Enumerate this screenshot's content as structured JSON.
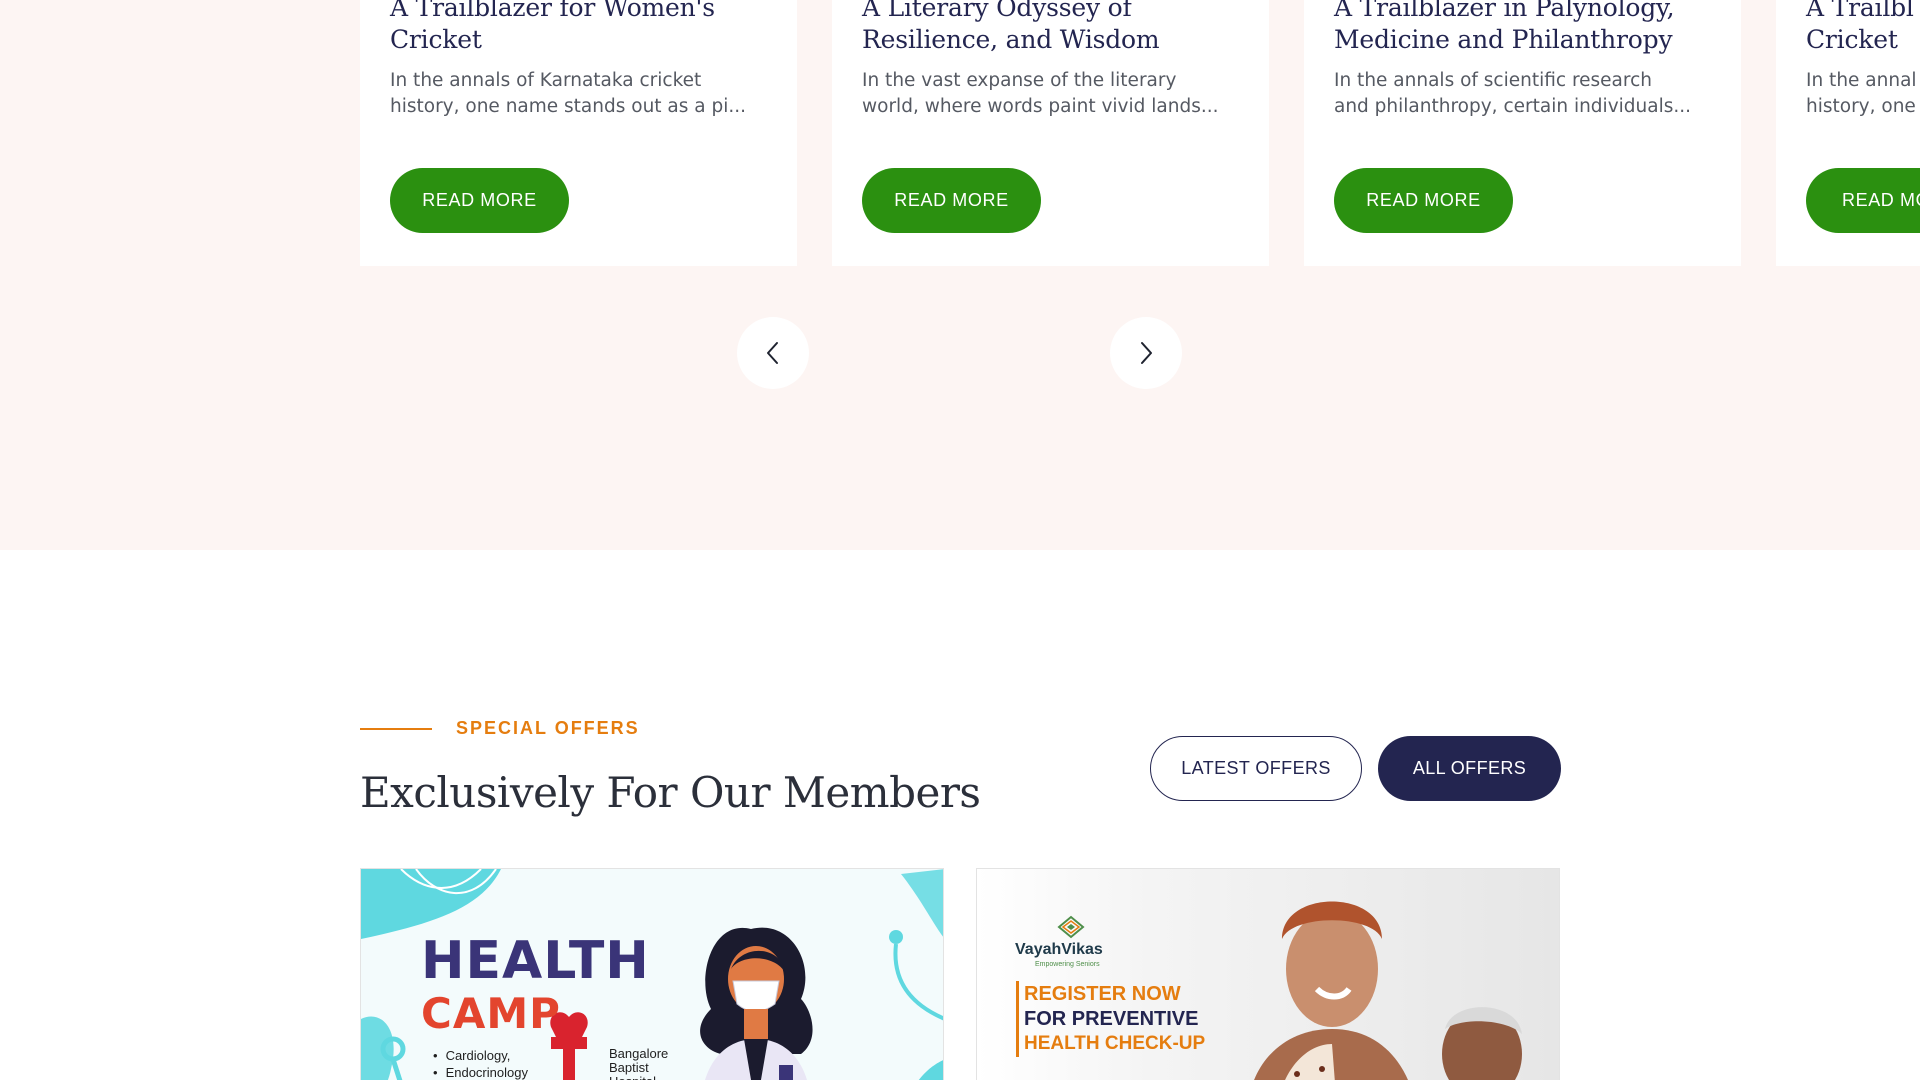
{
  "stories": {
    "cards": [
      {
        "title_line1": "A Trailblazer for Women's",
        "title_line2": "Cricket",
        "excerpt_line1": "In the annals of Karnataka cricket",
        "excerpt_line2": "history, one name stands out as a pi...",
        "button": "READ MORE"
      },
      {
        "title_line1": "A Literary Odyssey of",
        "title_line2": "Resilience, and Wisdom",
        "excerpt_line1": "In the vast expanse of the literary",
        "excerpt_line2": "world, where words paint vivid lands...",
        "button": "READ MORE"
      },
      {
        "title_line1": "A Trailblazer in Palynology,",
        "title_line2": "Medicine and Philanthropy",
        "excerpt_line1": "In the annals of scientific research",
        "excerpt_line2": "and philanthropy, certain individuals...",
        "button": "READ MORE"
      },
      {
        "title_line1": "A Trailbl",
        "title_line2": "Cricket",
        "excerpt_line1": "In the annal",
        "excerpt_line2": "history, one",
        "button": "READ MO"
      }
    ],
    "prev_icon": "chevron-left-icon",
    "next_icon": "chevron-right-icon"
  },
  "offers": {
    "eyebrow": "SPECIAL OFFERS",
    "title": "Exclusively For Our Members",
    "tabs": [
      {
        "label": "LATEST OFFERS",
        "active": false
      },
      {
        "label": "ALL OFFERS",
        "active": true
      }
    ],
    "cards": [
      {
        "line1": "HEALTH",
        "line2": "CAMP",
        "list": [
          "Cardiology,",
          "Endocrinology"
        ],
        "hospital": "Bangalore Baptist Hospital"
      },
      {
        "brand": "VayahVikas",
        "tagline": "Empowering Seniors",
        "line1": "REGISTER NOW",
        "line2": "FOR PREVENTIVE",
        "line3": "HEALTH CHECK-UP"
      }
    ]
  },
  "colors": {
    "accent_green": "#2b9010",
    "accent_orange": "#e57d0f",
    "navy": "#232550",
    "section_bg": "#fdf5f3"
  }
}
